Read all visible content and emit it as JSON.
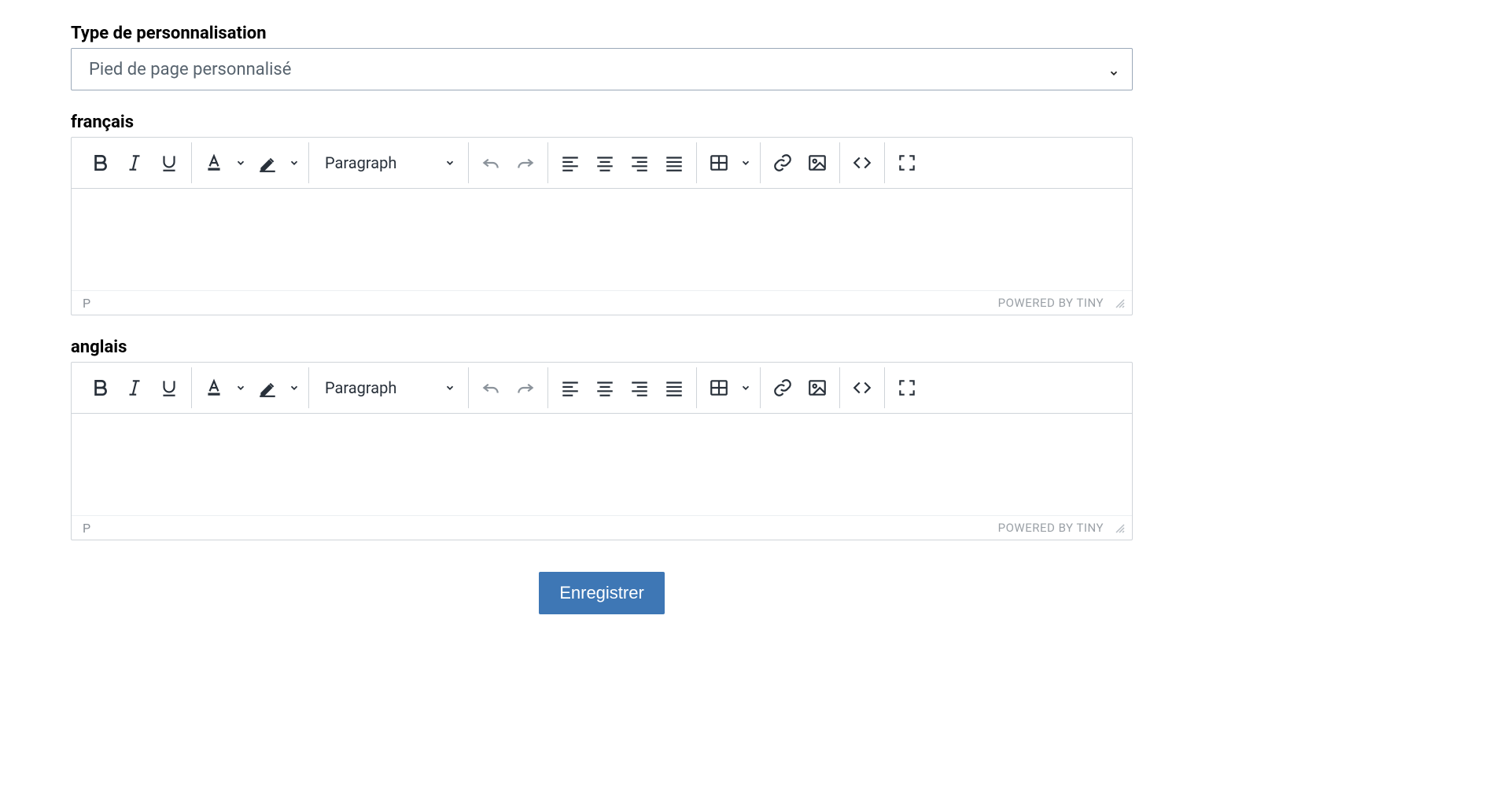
{
  "type_field": {
    "label": "Type de personnalisation",
    "selected": "Pied de page personnalisé"
  },
  "editors": [
    {
      "label": "français",
      "format": "Paragraph",
      "path": "P",
      "powered": "POWERED BY TINY"
    },
    {
      "label": "anglais",
      "format": "Paragraph",
      "path": "P",
      "powered": "POWERED BY TINY"
    }
  ],
  "actions": {
    "save": "Enregistrer"
  }
}
